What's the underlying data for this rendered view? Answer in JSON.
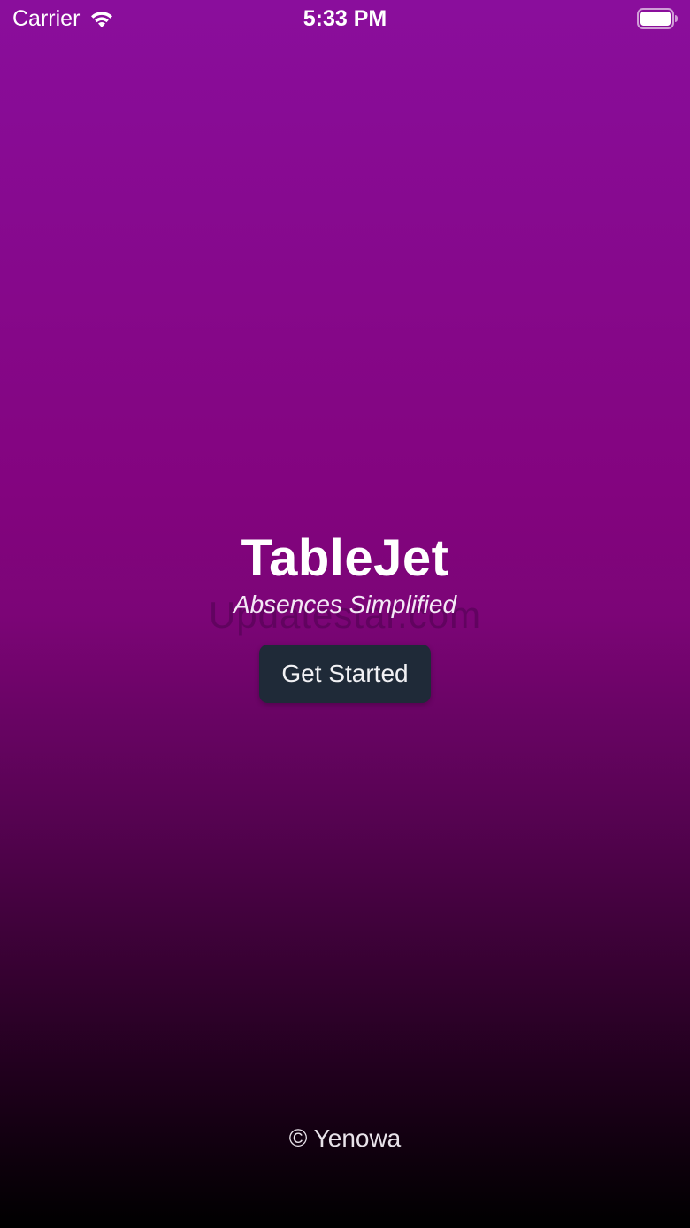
{
  "status_bar": {
    "carrier": "Carrier",
    "time": "5:33 PM",
    "wifi_icon": "wifi-icon",
    "battery_icon": "battery-icon"
  },
  "splash": {
    "title": "TableJet",
    "tagline": "Absences Simplified",
    "watermark": "Updatestar.com",
    "cta_label": "Get Started"
  },
  "footer": {
    "copyright": "© Yenowa"
  },
  "colors": {
    "gradient_top": "#8a0e9c",
    "gradient_mid": "#7c0577",
    "gradient_bottom": "#000000",
    "button_bg": "#1f2a38",
    "text": "#ffffff"
  }
}
